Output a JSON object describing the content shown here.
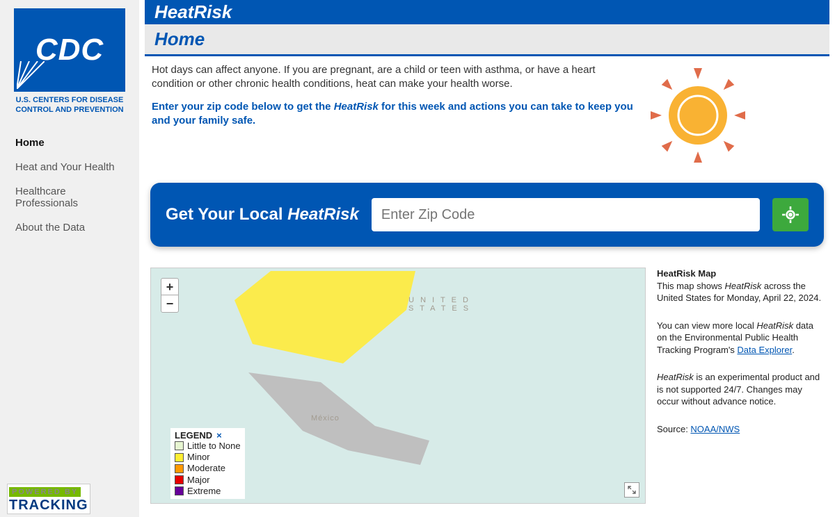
{
  "logo": {
    "letters": "CDC",
    "subtitle": "U.S. CENTERS FOR DISEASE CONTROL AND PREVENTION"
  },
  "nav": {
    "items": [
      {
        "label": "Home",
        "active": true
      },
      {
        "label": "Heat and Your Health"
      },
      {
        "label": "Healthcare Professionals"
      },
      {
        "label": "About the Data"
      }
    ]
  },
  "powered": {
    "top": "POWERED BY",
    "bottom": "TRACKING"
  },
  "header": {
    "title": "HeatRisk",
    "subtitle": "Home"
  },
  "intro": {
    "para1": "Hot days can affect anyone. If you are pregnant, are a child or teen with asthma, or have a heart condition or other chronic health conditions, heat can make your health worse.",
    "cta_pre": "Enter your zip code below to get the ",
    "cta_em": "HeatRisk",
    "cta_post": " for this week and actions you can take to keep you and your family safe."
  },
  "search": {
    "label_pre": "Get Your Local ",
    "label_em": "HeatRisk",
    "placeholder": "Enter Zip Code"
  },
  "map": {
    "labels": {
      "us": "U N I T E D\nS T A T E S",
      "mx": "México"
    },
    "legend": {
      "title": "LEGEND",
      "items": [
        {
          "label": "Little to None",
          "color": "#e6f5d0"
        },
        {
          "label": "Minor",
          "color": "#ffee33"
        },
        {
          "label": "Moderate",
          "color": "#ff9900"
        },
        {
          "label": "Major",
          "color": "#e60000"
        },
        {
          "label": "Extreme",
          "color": "#660099"
        }
      ]
    }
  },
  "info": {
    "hd": "HeatRisk Map",
    "p1_pre": "This map shows ",
    "p1_em": "HeatRisk",
    "p1_post": " across the United States for Monday, April 22, 2024.",
    "p2_pre": "You can view more local ",
    "p2_em": "HeatRisk",
    "p2_post": " data on the Environmental Public Health Tracking Program's ",
    "p2_link": "Data Explorer",
    "p2_after": ".",
    "p3_em": "HeatRisk",
    "p3_post": " is an experimental product and is not supported 24/7. Changes may occur without advance notice.",
    "src_label": "Source: ",
    "src_link": "NOAA/NWS"
  }
}
